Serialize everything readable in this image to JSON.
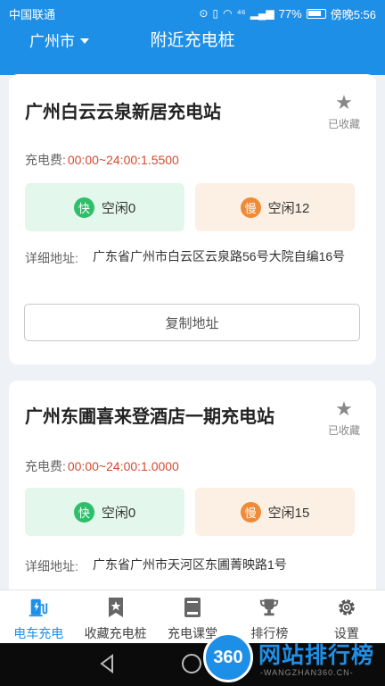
{
  "status_bar": {
    "carrier": "中国联通",
    "signal": "⁴⁶",
    "battery": "77%",
    "time": "傍晚5:56"
  },
  "header": {
    "city": "广州市",
    "title": "附近充电桩"
  },
  "stations": [
    {
      "name": "广州白云云泉新居充电站",
      "fav_label": "已收藏",
      "fee_label": "充电费:",
      "fee_value": "00:00~24:00:1.5500",
      "fast_badge": "快",
      "fast_text": "空闲0",
      "slow_badge": "慢",
      "slow_text": "空闲12",
      "address_label": "详细地址:",
      "address": "广东省广州市白云区云泉路56号大院自编16号",
      "copy_label": "复制地址"
    },
    {
      "name": "广州东圃喜来登酒店一期充电站",
      "fav_label": "已收藏",
      "fee_label": "充电费:",
      "fee_value": "00:00~24:00:1.0000",
      "fast_badge": "快",
      "fast_text": "空闲0",
      "slow_badge": "慢",
      "slow_text": "空闲15",
      "address_label": "详细地址:",
      "address": "广东省广州市天河区东圃菁映路1号"
    }
  ],
  "tabs": [
    {
      "label": "电车充电",
      "icon": "ev-charger-icon",
      "active": true
    },
    {
      "label": "收藏充电桩",
      "icon": "bookmark-star-icon",
      "active": false
    },
    {
      "label": "充电课堂",
      "icon": "book-icon",
      "active": false
    },
    {
      "label": "排行榜",
      "icon": "trophy-icon",
      "active": false
    },
    {
      "label": "设置",
      "icon": "gear-icon",
      "active": false
    }
  ],
  "watermark": {
    "logo": "360",
    "text": "网站排行榜",
    "sub": "-WANGZHAN360.CN-"
  },
  "colors": {
    "primary": "#1e8fe7",
    "fee": "#d84a2e",
    "fast": "#2fbf6a",
    "slow": "#ef8a36"
  }
}
